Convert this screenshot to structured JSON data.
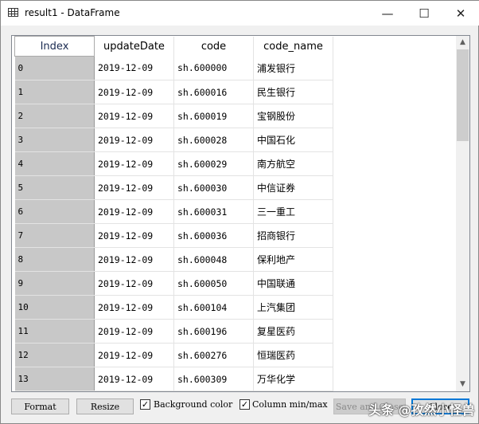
{
  "window": {
    "title": "result1 - DataFrame",
    "minimize": "—",
    "maximize": "☐",
    "close": "✕"
  },
  "table": {
    "columns": [
      "Index",
      "updateDate",
      "code",
      "code_name"
    ],
    "rows": [
      [
        "0",
        "2019-12-09",
        "sh.600000",
        "浦发银行"
      ],
      [
        "1",
        "2019-12-09",
        "sh.600016",
        "民生银行"
      ],
      [
        "2",
        "2019-12-09",
        "sh.600019",
        "宝钢股份"
      ],
      [
        "3",
        "2019-12-09",
        "sh.600028",
        "中国石化"
      ],
      [
        "4",
        "2019-12-09",
        "sh.600029",
        "南方航空"
      ],
      [
        "5",
        "2019-12-09",
        "sh.600030",
        "中信证券"
      ],
      [
        "6",
        "2019-12-09",
        "sh.600031",
        "三一重工"
      ],
      [
        "7",
        "2019-12-09",
        "sh.600036",
        "招商银行"
      ],
      [
        "8",
        "2019-12-09",
        "sh.600048",
        "保利地产"
      ],
      [
        "9",
        "2019-12-09",
        "sh.600050",
        "中国联通"
      ],
      [
        "10",
        "2019-12-09",
        "sh.600104",
        "上汽集团"
      ],
      [
        "11",
        "2019-12-09",
        "sh.600196",
        "复星医药"
      ],
      [
        "12",
        "2019-12-09",
        "sh.600276",
        "恒瑞医药"
      ],
      [
        "13",
        "2019-12-09",
        "sh.600309",
        "万华化学"
      ]
    ]
  },
  "footer": {
    "format": "Format",
    "resize": "Resize",
    "background_color": "Background color",
    "background_color_checked": true,
    "column_minmax": "Column min/max",
    "column_minmax_checked": true,
    "save_and_close": "Save and Close",
    "close": "Close"
  },
  "watermark": "头条 @孜然小怪兽"
}
